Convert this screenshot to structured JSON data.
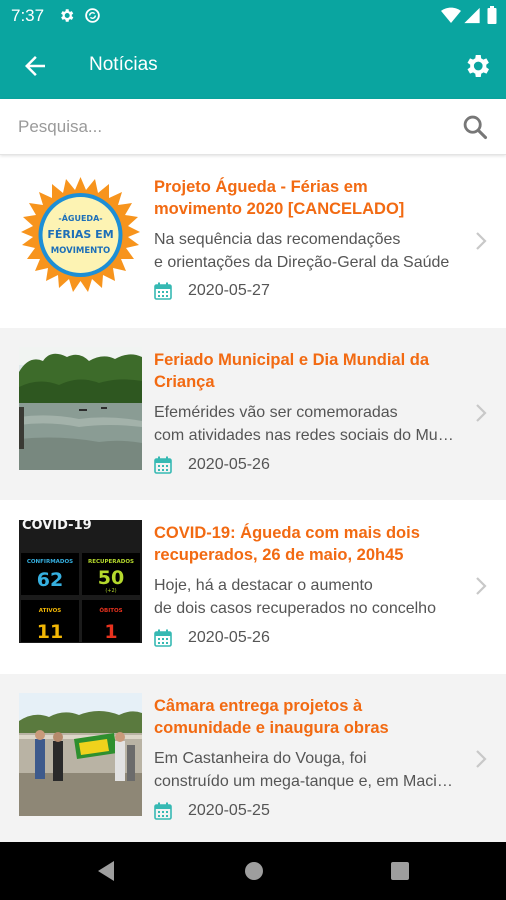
{
  "status_bar": {
    "time": "7:37"
  },
  "app_bar": {
    "title": "Notícias"
  },
  "search": {
    "placeholder": "Pesquisa..."
  },
  "news": [
    {
      "title_line1": "Projeto Águeda - Férias em",
      "title_line2": "movimento 2020 [CANCELADO]",
      "desc_line1": "Na sequência das recomendações",
      "desc_line2": "e orientações da Direção-Geral da Saúde",
      "date": "2020-05-27",
      "thumb": {
        "top_text": "-ÁGUEDA-",
        "mid_text": "FÉRIAS EM",
        "bottom_text": "MOVIMENTO"
      }
    },
    {
      "title_line1": "Feriado Municipal e Dia Mundial da",
      "title_line2": "Criança",
      "desc_line1": "Efemérides vão ser comemoradas",
      "desc_line2": "com atividades nas redes sociais do Município",
      "date": "2020-05-26"
    },
    {
      "title_line1": "COVID-19: Águeda com mais dois",
      "title_line2": "recuperados, 26 de maio, 20h45",
      "desc_line1": "Hoje, há a destacar o aumento",
      "desc_line2": "de dois casos recuperados no concelho",
      "date": "2020-05-26",
      "thumb": {
        "header": "COVID-19",
        "confirmed_label": "CONFIRMADOS",
        "confirmed_value": "62",
        "recovered_label": "RECUPERADOS",
        "recovered_value": "50",
        "recovered_delta": "(+2)",
        "active_label": "ATIVOS",
        "active_value": "11",
        "deaths_label": "ÓBITOS",
        "deaths_value": "1"
      }
    },
    {
      "title_line1": "Câmara entrega projetos à",
      "title_line2": "comunidade e inaugura obras",
      "desc_line1": "Em Castanheira do Vouga, foi",
      "desc_line2": "construído um mega-tanque e, em Macinhata",
      "date": "2020-05-25"
    }
  ],
  "colors": {
    "primary": "#0aa5a0",
    "title_orange": "#f26a12",
    "calendar_teal": "#36b9b3",
    "alt_row": "#f3f3f3"
  },
  "icons": [
    "back-arrow-icon",
    "settings-gear-icon",
    "search-icon",
    "calendar-icon",
    "chevron-right-icon"
  ]
}
